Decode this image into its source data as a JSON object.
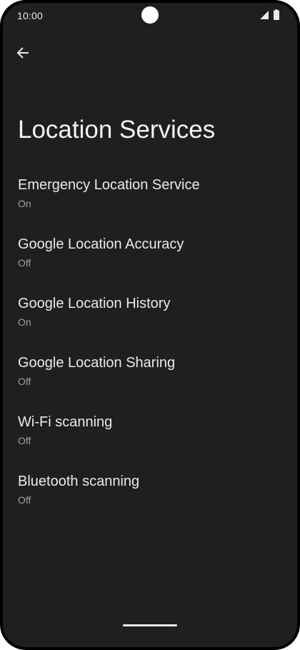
{
  "status_bar": {
    "time": "10:00",
    "icons": [
      "signal-icon",
      "battery-icon"
    ]
  },
  "header": {
    "back_icon": "arrow-back-icon"
  },
  "page": {
    "title": "Location Services"
  },
  "settings": {
    "items": [
      {
        "title": "Emergency Location Service",
        "summary": "On"
      },
      {
        "title": "Google Location Accuracy",
        "summary": "Off"
      },
      {
        "title": "Google Location History",
        "summary": "On"
      },
      {
        "title": "Google Location Sharing",
        "summary": "Off"
      },
      {
        "title": "Wi-Fi scanning",
        "summary": "Off"
      },
      {
        "title": "Bluetooth scanning",
        "summary": "Off"
      }
    ]
  },
  "colors": {
    "background": "#1f201d",
    "text_primary": "#e8eaed",
    "text_secondary": "#9aa0a6"
  }
}
